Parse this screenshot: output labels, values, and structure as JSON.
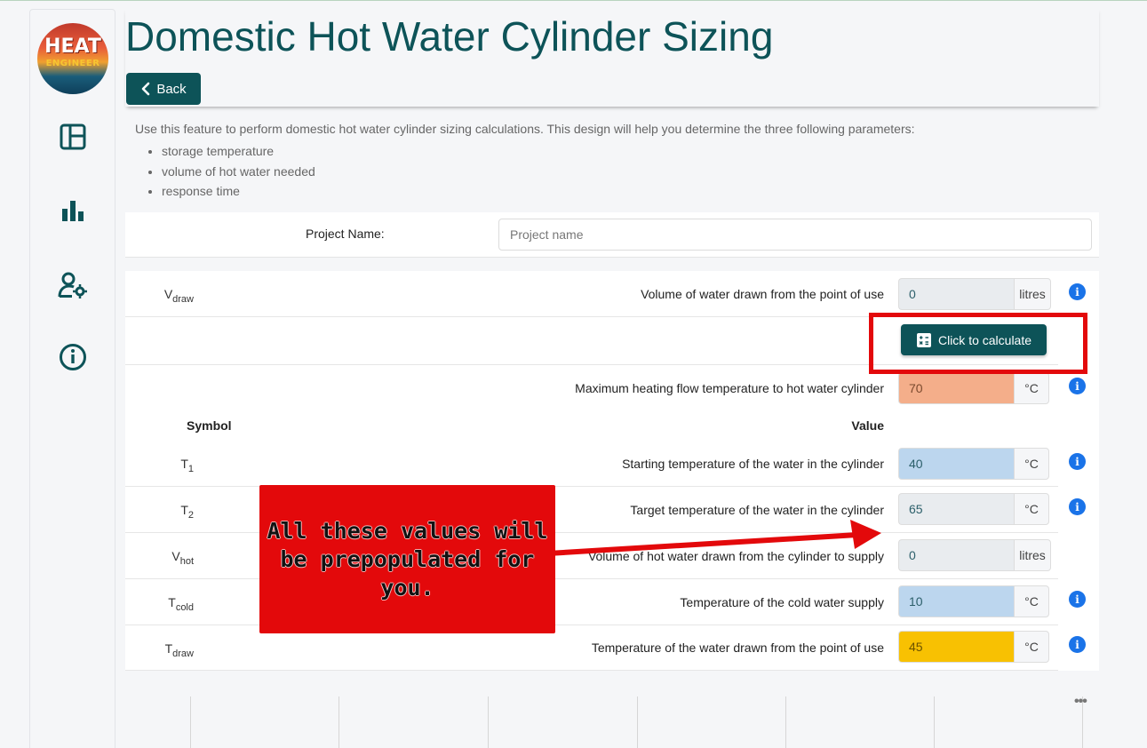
{
  "sidebar": {
    "logo_line1": "HEAT",
    "logo_line2": "ENGINEER",
    "nav": [
      {
        "icon": "layout-icon"
      },
      {
        "icon": "bar-chart-icon"
      },
      {
        "icon": "user-settings-icon"
      },
      {
        "icon": "info-circle-icon"
      }
    ]
  },
  "header": {
    "title": "Domestic Hot Water Cylinder Sizing",
    "back_label": "Back"
  },
  "intro": {
    "text": "Use this feature to perform domestic hot water cylinder sizing calculations. This design will help you determine the three following parameters:",
    "bullets": [
      "storage temperature",
      "volume of hot water needed",
      "response time"
    ]
  },
  "project": {
    "label": "Project Name:",
    "placeholder": "Project name",
    "value": ""
  },
  "form": {
    "vdraw": {
      "symbol": "V",
      "sub": "draw",
      "desc": "Volume of water drawn from the point of use",
      "value": "0",
      "unit": "litres"
    },
    "calculate_label": "Click to calculate",
    "max_flow": {
      "desc": "Maximum heating flow temperature to hot water cylinder",
      "value": "70",
      "unit": "°C"
    },
    "headers": {
      "symbol": "Symbol",
      "value": "Value"
    },
    "t1": {
      "symbol": "T",
      "sub": "1",
      "desc": "Starting temperature of the water in the cylinder",
      "value": "40",
      "unit": "°C"
    },
    "t2": {
      "symbol": "T",
      "sub": "2",
      "desc": "Target temperature of the water in the cylinder",
      "value": "65",
      "unit": "°C"
    },
    "vhot": {
      "symbol": "V",
      "sub": "hot",
      "desc": "Volume of hot water drawn from the cylinder to supply",
      "value": "0",
      "unit": "litres"
    },
    "tcold": {
      "symbol": "T",
      "sub": "cold",
      "desc": "Temperature of the cold water supply",
      "value": "10",
      "unit": "°C"
    },
    "tdraw": {
      "symbol": "T",
      "sub": "draw",
      "desc": "Temperature of the water drawn from the point of use",
      "value": "45",
      "unit": "°C"
    }
  },
  "colors": {
    "primary": "#0d5358",
    "field_grey": "#e9ecef",
    "field_orange": "#f4ae8a",
    "field_blue": "#bcd6ee",
    "field_yellow": "#f8c102",
    "info_blue": "#1a73e8",
    "annotation_red": "#e3090b"
  },
  "annotation": {
    "callout_text": "All these values will be prepopulated for you."
  },
  "footer": {
    "more_label": "•••"
  }
}
